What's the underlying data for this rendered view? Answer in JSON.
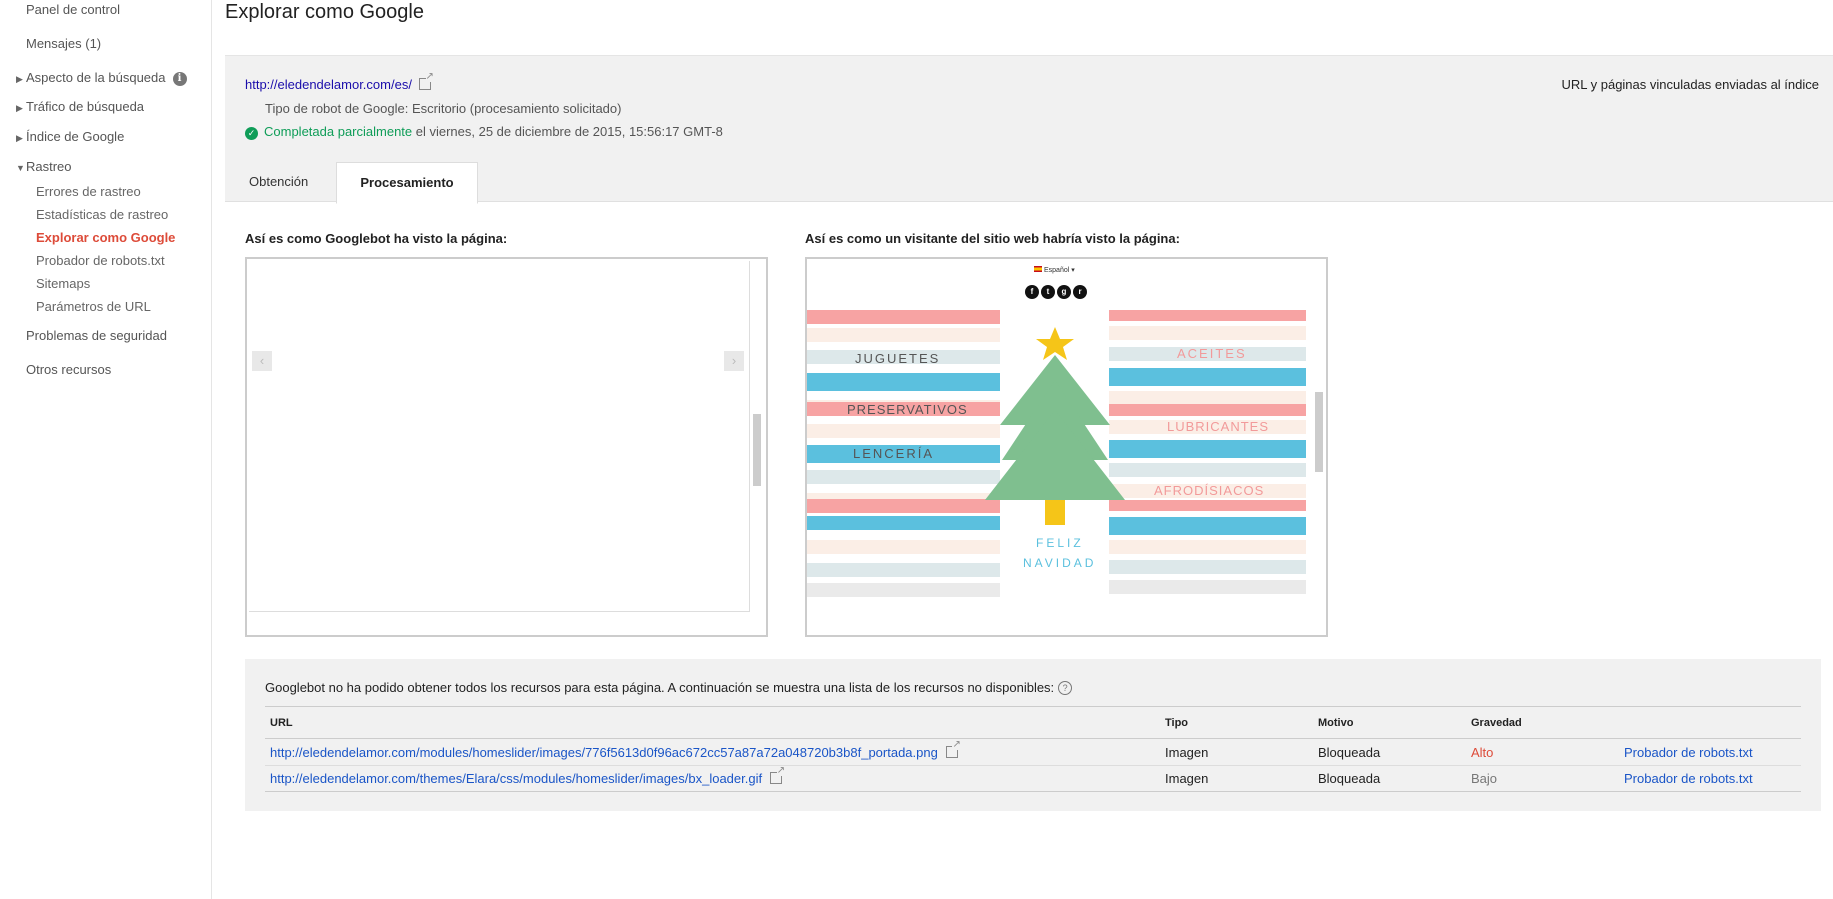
{
  "sidebar": {
    "items": [
      {
        "label": "Panel de control"
      },
      {
        "label": "Mensajes (1)"
      },
      {
        "label": "Aspecto de la búsqueda"
      },
      {
        "label": "Tráfico de búsqueda"
      },
      {
        "label": "Índice de Google"
      },
      {
        "label": "Rastreo"
      },
      {
        "label": "Problemas de seguridad"
      },
      {
        "label": "Otros recursos"
      }
    ],
    "rastreo_sub": [
      {
        "label": "Errores de rastreo"
      },
      {
        "label": "Estadísticas de rastreo"
      },
      {
        "label": "Explorar como Google"
      },
      {
        "label": "Probador de robots.txt"
      },
      {
        "label": "Sitemaps"
      },
      {
        "label": "Parámetros de URL"
      }
    ],
    "info_glyph": "i"
  },
  "page": {
    "title": "Explorar como Google"
  },
  "header": {
    "url": "http://eledendelamor.com/es/",
    "robot_type": "Tipo de robot de Google: Escritorio (procesamiento solicitado)",
    "status_label": "Completada parcialmente",
    "status_date": " el viernes, 25 de diciembre de 2015, 15:56:17 GMT-8",
    "right_text": "URL y páginas vinculadas enviadas al índice"
  },
  "tabs": [
    {
      "label": "Obtención"
    },
    {
      "label": "Procesamiento"
    }
  ],
  "panels": {
    "googlebot_label": "Así es como Googlebot ha visto la página:",
    "visitor_label": "Así es como un visitante del sitio web habría visto la página:"
  },
  "render": {
    "lang": "Español",
    "left_words": [
      "JUGUETES",
      "PRESERVATIVOS",
      "LENCERÍA"
    ],
    "right_words": [
      "ACEITES",
      "LUBRICANTES",
      "AFRODÍSIACOS"
    ],
    "greeting": [
      "FELIZ",
      "NAVIDAD"
    ],
    "social": [
      "f",
      "t",
      "g",
      "r"
    ]
  },
  "resources": {
    "intro": "Googlebot no ha podido obtener todos los recursos para esta página. A continuación se muestra una lista de los recursos no disponibles:",
    "headers": {
      "url": "URL",
      "tipo": "Tipo",
      "motivo": "Motivo",
      "gravedad": "Gravedad"
    },
    "rows": [
      {
        "url": "http://eledendelamor.com/modules/homeslider/images/776f5613d0f96ac672cc57a87a72a048720b3b8f_portada.png",
        "tipo": "Imagen",
        "motivo": "Bloqueada",
        "gravedad": "Alto",
        "action": "Probador de robots.txt"
      },
      {
        "url": "http://eledendelamor.com/themes/Elara/css/modules/homeslider/images/bx_loader.gif",
        "tipo": "Imagen",
        "motivo": "Bloqueada",
        "gravedad": "Bajo",
        "action": "Probador de robots.txt"
      }
    ]
  },
  "colors": {
    "accent_red": "#dd4b39",
    "link_blue": "#1a55c7",
    "success_green": "#0f9d58",
    "stripe_pink": "#f7a3a3",
    "stripe_blue": "#5bc0de",
    "tree_green": "#7fbf8f",
    "star_yellow": "#f5c518"
  }
}
